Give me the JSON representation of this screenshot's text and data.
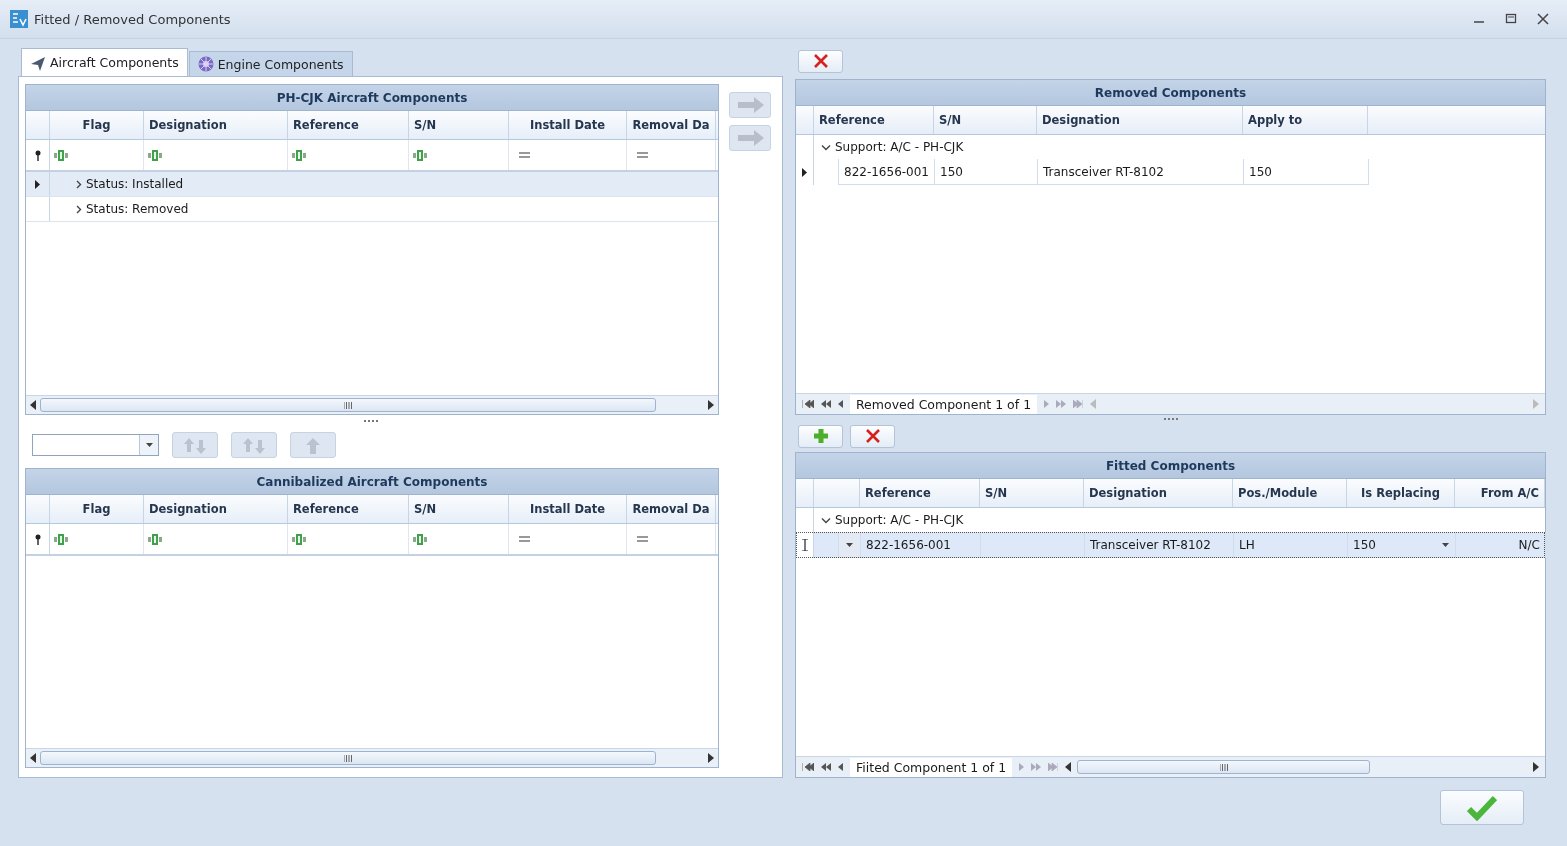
{
  "window": {
    "title": "Fitted / Removed Components"
  },
  "tabs": [
    {
      "label": "Aircraft Components",
      "selected": true,
      "kind": "aircraft"
    },
    {
      "label": "Engine Components",
      "selected": false,
      "kind": "engine"
    }
  ],
  "aircraft_grid": {
    "title": "PH-CJK Aircraft Components",
    "columns": [
      "Flag",
      "Designation",
      "Reference",
      "S/N",
      "Install Date",
      "Removal Da"
    ],
    "filters": [
      {
        "kind": "text"
      },
      {
        "kind": "text"
      },
      {
        "kind": "text"
      },
      {
        "kind": "text"
      },
      {
        "kind": "date"
      },
      {
        "kind": "date"
      }
    ],
    "groups": [
      {
        "label": "Status: Installed",
        "selected": true,
        "expanded": false
      },
      {
        "label": "Status: Removed",
        "selected": false,
        "expanded": false
      }
    ]
  },
  "transfer_buttons": [
    {
      "disabled": true
    },
    {
      "disabled": true
    }
  ],
  "order_buttons": [
    {
      "kind": "up-down",
      "disabled": true
    },
    {
      "kind": "up-down",
      "disabled": true
    },
    {
      "kind": "up",
      "disabled": true
    }
  ],
  "cannibalized_grid": {
    "title": "Cannibalized Aircraft Components",
    "columns": [
      "Flag",
      "Designation",
      "Reference",
      "S/N",
      "Install Date",
      "Removal Da"
    ],
    "filters": [
      {
        "kind": "text"
      },
      {
        "kind": "text"
      },
      {
        "kind": "text"
      },
      {
        "kind": "text"
      },
      {
        "kind": "date"
      },
      {
        "kind": "date"
      }
    ]
  },
  "removed_grid": {
    "title": "Removed Components",
    "columns": [
      "Reference",
      "S/N",
      "Designation",
      "Apply to"
    ],
    "groups": [
      {
        "label": "Support: A/C - PH-CJK",
        "expanded": true,
        "rows": [
          {
            "cells": [
              "822-1656-001",
              "150",
              "Transceiver RT-8102",
              "150"
            ],
            "current": true
          }
        ]
      }
    ],
    "navigator": "Removed Component 1 of 1"
  },
  "fitted_grid": {
    "title": "Fitted Components",
    "columns": [
      "Reference",
      "S/N",
      "Designation",
      "Pos./Module",
      "Is Replacing",
      "From A/C"
    ],
    "groups": [
      {
        "label": "Support: A/C - PH-CJK",
        "expanded": true,
        "rows": [
          {
            "cells": [
              "822-1656-001",
              null,
              "Transceiver RT-8102",
              "LH",
              "150",
              "N/C"
            ],
            "selected": true,
            "editing": true
          }
        ]
      }
    ],
    "navigator": "Fiited Component 1 of 1"
  }
}
